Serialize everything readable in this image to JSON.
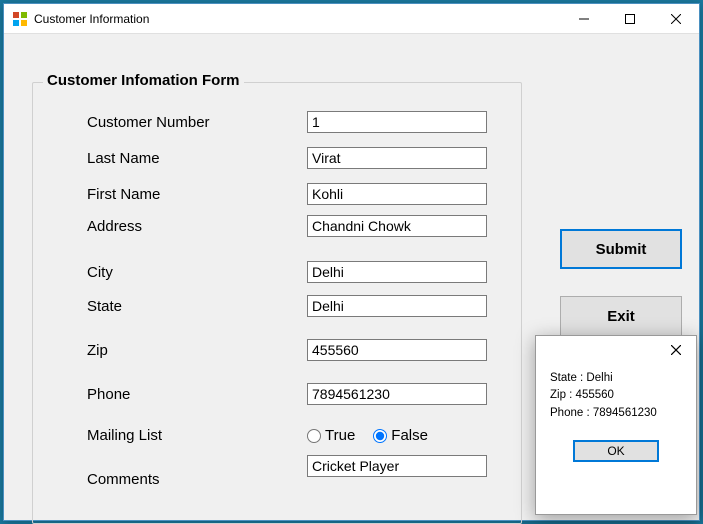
{
  "window": {
    "title": "Customer Information"
  },
  "form": {
    "legend": "Customer Infomation Form",
    "labels": {
      "customer_number": "Customer Number",
      "last_name": "Last Name",
      "first_name": "First Name",
      "address": "Address",
      "city": "City",
      "state": "State",
      "zip": "Zip",
      "phone": "Phone",
      "mailing_list": "Mailing List",
      "comments": "Comments"
    },
    "values": {
      "customer_number": "1",
      "last_name": "Virat",
      "first_name": "Kohli",
      "address": "Chandni Chowk",
      "city": "Delhi",
      "state": "Delhi",
      "zip": "455560",
      "phone": "7894561230",
      "comments": "Cricket Player"
    },
    "mailing_options": {
      "true": "True",
      "false": "False",
      "selected": "false"
    }
  },
  "buttons": {
    "submit": "Submit",
    "exit": "Exit"
  },
  "dialog": {
    "lines": {
      "state": "State : Delhi",
      "zip": "Zip : 455560",
      "phone": " Phone : 7894561230"
    },
    "ok": "OK"
  }
}
